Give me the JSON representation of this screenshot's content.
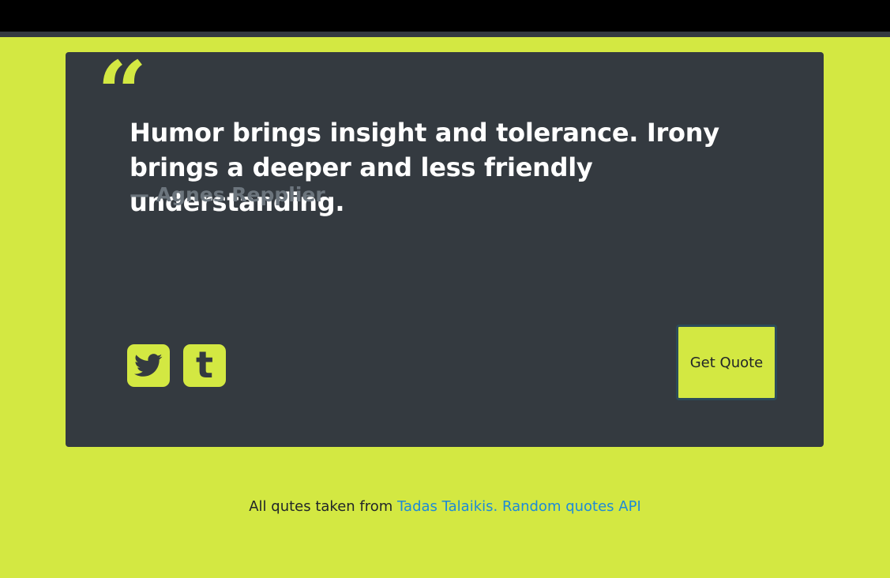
{
  "quote": {
    "mark": "“",
    "text": "Humor brings insight and tolerance. Irony brings a deeper and less friendly understanding.",
    "author": "— Agnes Repplier"
  },
  "share": {
    "twitter_icon": "twitter-icon",
    "tumblr_icon": "tumblr-icon",
    "tumblr_glyph": "t"
  },
  "actions": {
    "get_quote_label": "Get Quote"
  },
  "footer": {
    "prefix": "All qutes taken from ",
    "link_text": "Tadas Talaikis. Random quotes API"
  },
  "colors": {
    "background": "#d3e842",
    "card": "#343a40",
    "accent": "#d3e842",
    "author_text": "#6c757d",
    "link": "#1d8ad8"
  }
}
